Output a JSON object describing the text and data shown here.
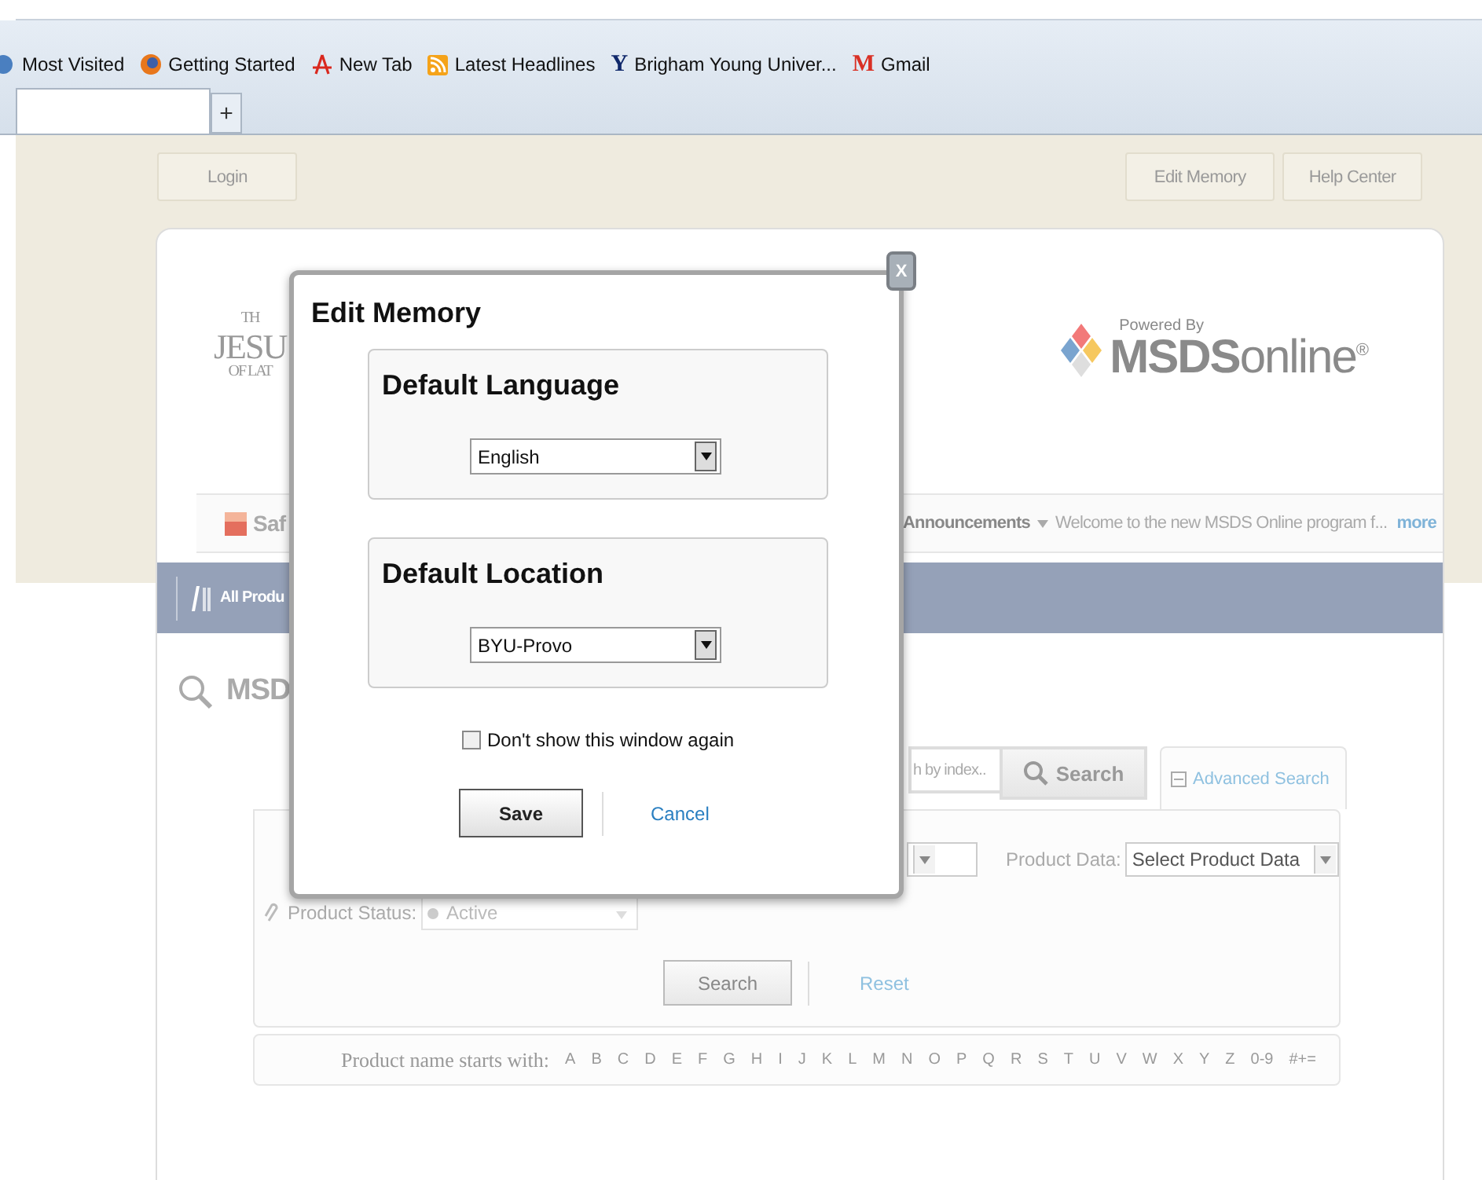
{
  "browser": {
    "bookmarks": [
      {
        "label": "Most Visited"
      },
      {
        "label": "Getting Started"
      },
      {
        "label": "New Tab"
      },
      {
        "label": "Latest Headlines"
      },
      {
        "label": "Brigham Young Univer...",
        "glyph": "Y"
      },
      {
        "label": "Gmail",
        "glyph": "M"
      }
    ],
    "new_tab_button": "+"
  },
  "header": {
    "login": "Login",
    "buttons": [
      "Edit Memory",
      "Help Center"
    ]
  },
  "church_logo": {
    "lines": [
      "TH",
      "JESU",
      "OF LAT"
    ]
  },
  "powered": {
    "caption": "Powered By",
    "brand": "**MSDS**online$^{®}$"
  },
  "nav": {
    "tab": "Saf",
    "announcements": "Announcements",
    "message": "Welcome to the new MSDS Online program f...",
    "more": "more"
  },
  "category_bar": {
    "item": "All Produ"
  },
  "page_title": "MSD",
  "search": {
    "placeholder": "h by index..",
    "button": "Search",
    "advanced": "Advanced Search"
  },
  "advanced": {
    "product_data_label": "Product Data:",
    "product_data": "Select Product Data",
    "product_status_label": "Product Status:",
    "product_status": "Active",
    "search": "Search",
    "reset": "Reset"
  },
  "alphabet": {
    "label": "Product name starts with:",
    "letters": [
      "A",
      "B",
      "C",
      "D",
      "E",
      "F",
      "G",
      "H",
      "I",
      "J",
      "K",
      "L",
      "M",
      "N",
      "O",
      "P",
      "Q",
      "R",
      "S",
      "T",
      "U",
      "V",
      "W",
      "X",
      "Y",
      "Z",
      "0-9",
      "#+="
    ]
  },
  "dialog": {
    "title": "Edit Memory",
    "close": "X",
    "sections": [
      {
        "heading": "Default Language",
        "value": "English"
      },
      {
        "heading": "Default Location",
        "value": "BYU-Provo"
      }
    ],
    "dont_show": {
      "label": "Don't show this window again",
      "checked": false
    },
    "save": "Save",
    "cancel": "Cancel"
  }
}
